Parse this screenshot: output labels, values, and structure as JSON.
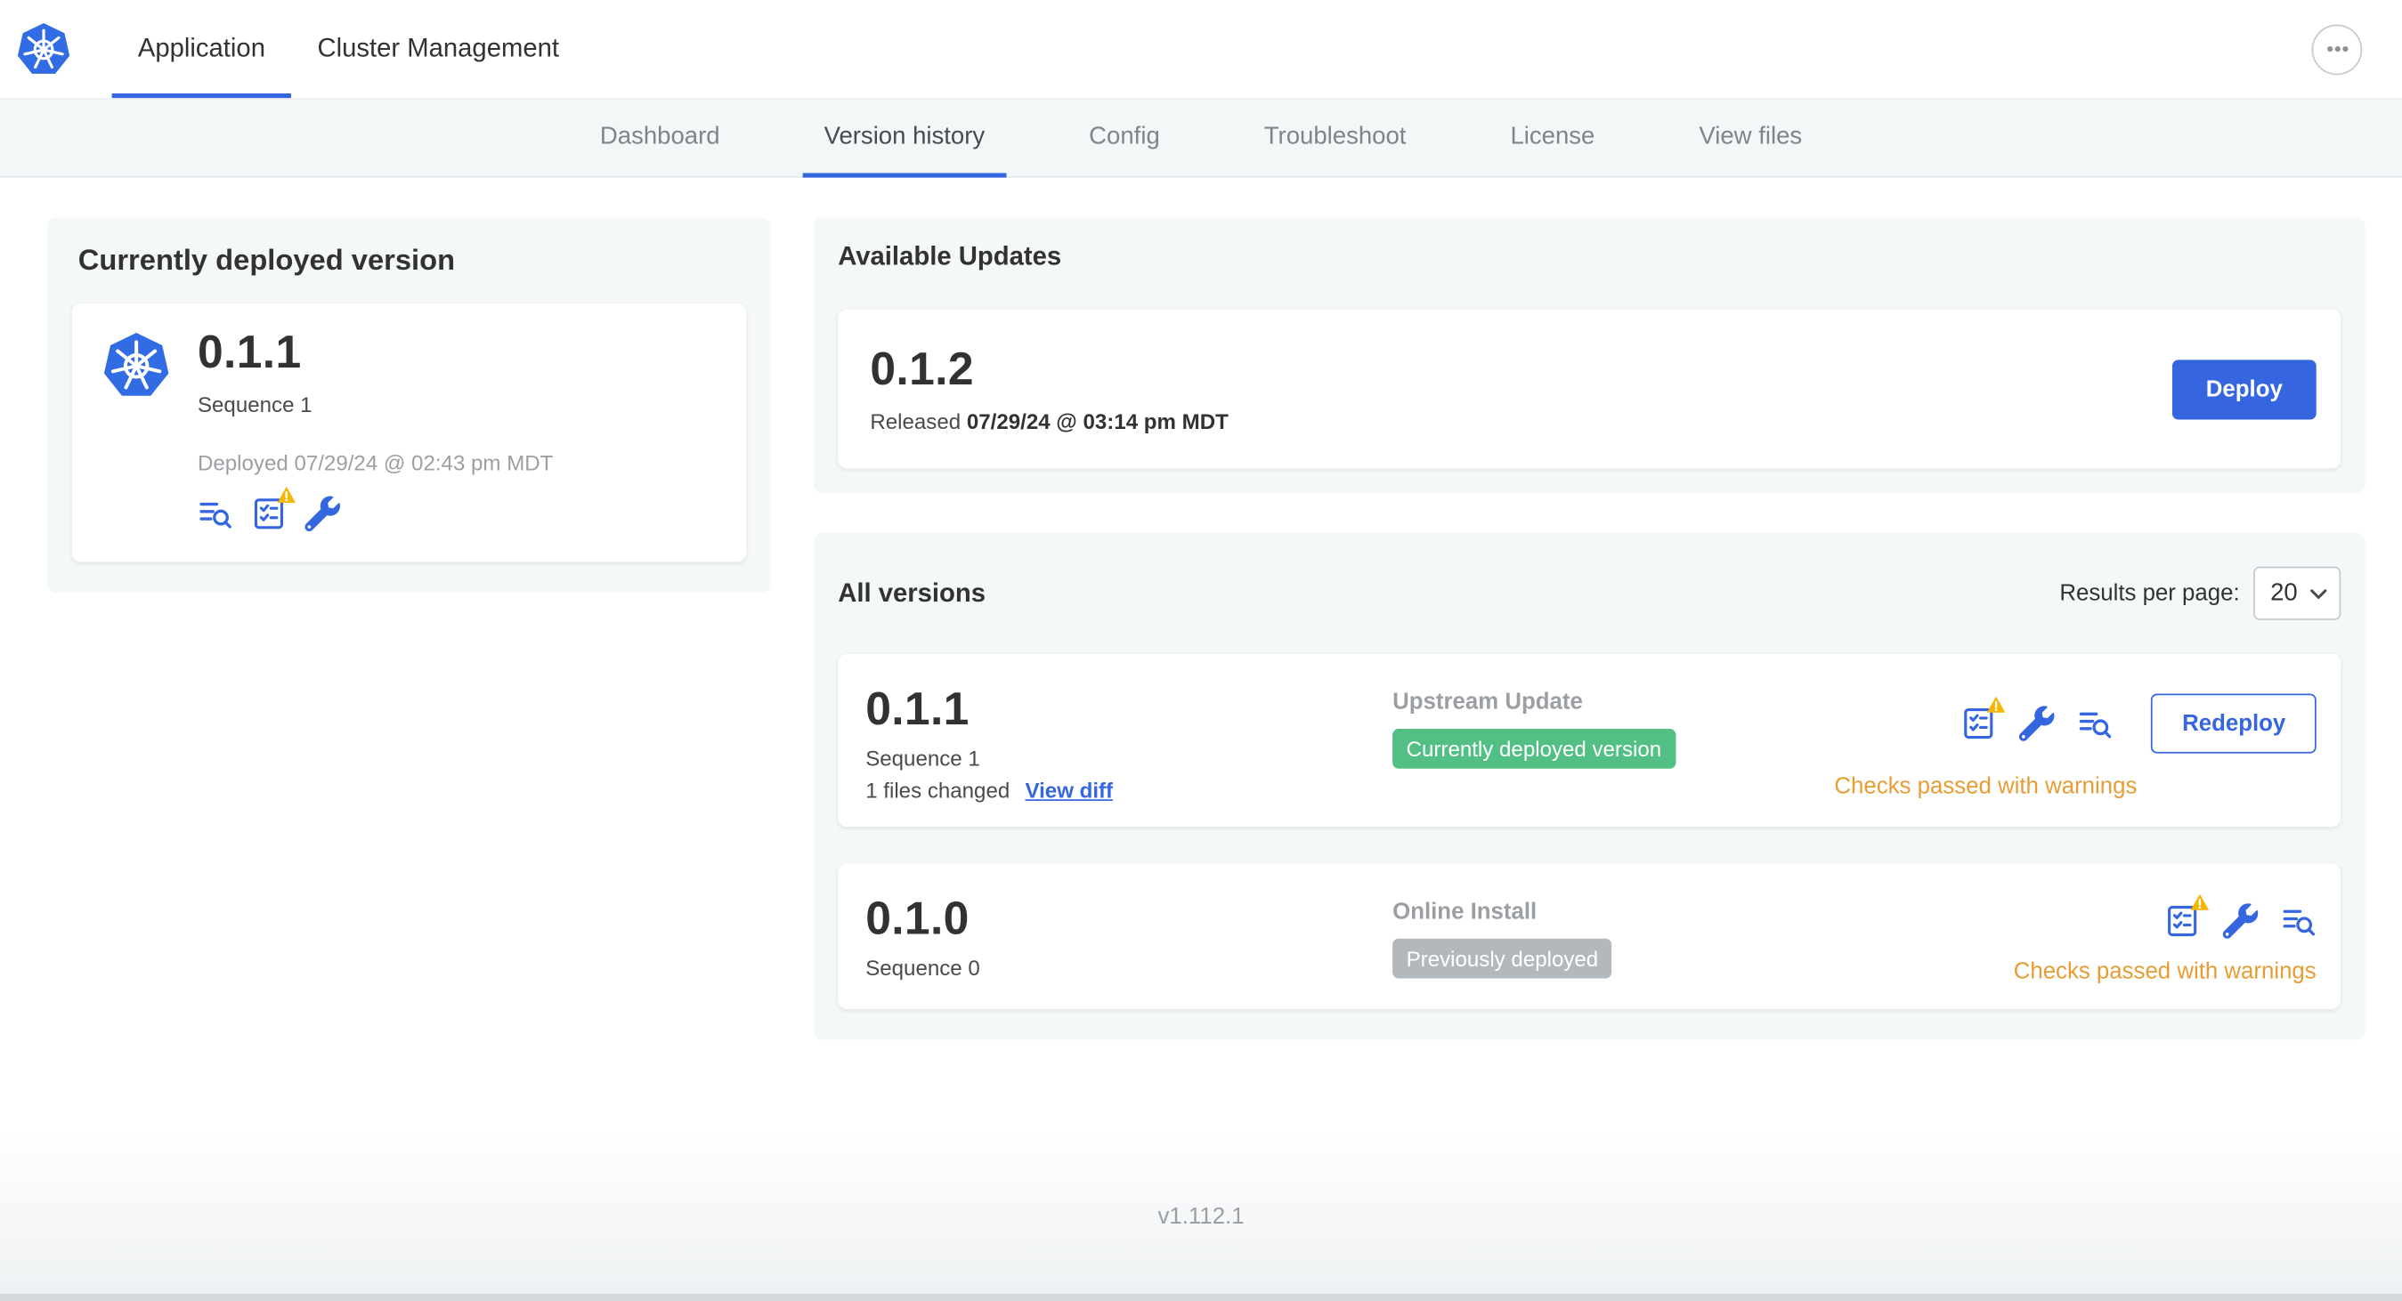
{
  "colors": {
    "accent": "#3566e0",
    "k8s_blue": "#326ce5",
    "warning_text": "#e89c31",
    "warning_triangle": "#f7b500",
    "badge_green": "#52c084",
    "badge_gray": "#b2b8bc"
  },
  "icons": {
    "logo": "kubernetes-logo",
    "deploy_logs": "deploy-logs-icon",
    "preflight_checks": "preflight-checks-icon",
    "edit_config": "edit-config-icon",
    "warning": "warning-triangle-icon",
    "more_menu": "ellipsis-icon",
    "select_chevron": "chevron-down-icon"
  },
  "topbar": {
    "tabs": [
      {
        "label": "Application"
      },
      {
        "label": "Cluster Management"
      }
    ]
  },
  "subnav": {
    "items": [
      {
        "label": "Dashboard"
      },
      {
        "label": "Version history"
      },
      {
        "label": "Config"
      },
      {
        "label": "Troubleshoot"
      },
      {
        "label": "License"
      },
      {
        "label": "View files"
      }
    ]
  },
  "current_version": {
    "title": "Currently deployed version",
    "version": "0.1.1",
    "sequence": "Sequence 1",
    "deployed": "Deployed 07/29/24 @ 02:43 pm MDT"
  },
  "available_updates": {
    "title": "Available Updates",
    "version": "0.1.2",
    "released_prefix": "Released",
    "released_date": "07/29/24 @ 03:14 pm MDT",
    "deploy_label": "Deploy"
  },
  "all_versions": {
    "title": "All versions",
    "results_per_page_label": "Results per page:",
    "results_per_page_value": "20",
    "rows": [
      {
        "version": "0.1.1",
        "sequence": "Sequence 1",
        "files_changed": "1 files changed",
        "view_diff_label": "View diff",
        "source": "Upstream Update",
        "badge": "Currently deployed version",
        "badge_color": "#52c084",
        "status": "Checks passed with warnings",
        "action_label": "Redeploy"
      },
      {
        "version": "0.1.0",
        "sequence": "Sequence 0",
        "source": "Online Install",
        "badge": "Previously deployed",
        "badge_color": "#b2b8bc",
        "status": "Checks passed with warnings"
      }
    ]
  },
  "footer": {
    "version": "v1.112.1"
  }
}
